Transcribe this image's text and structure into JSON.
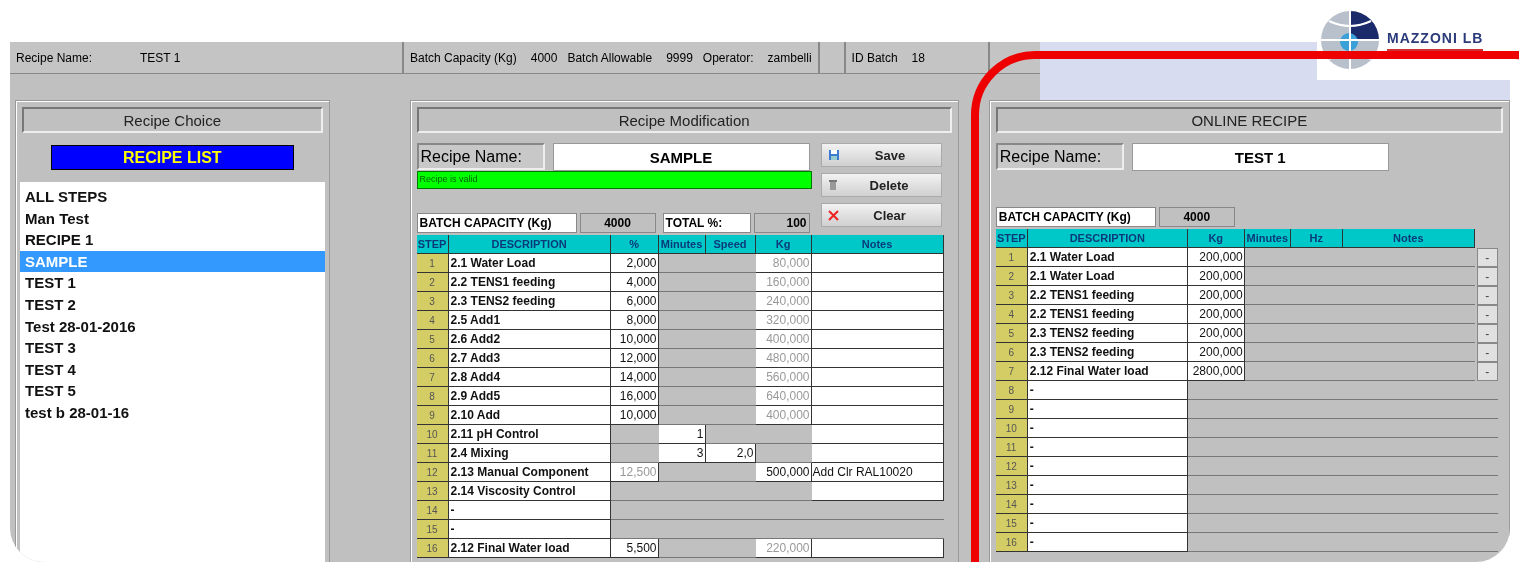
{
  "header": {
    "fields": [
      {
        "label": "Recipe Name:",
        "value": "TEST 1"
      },
      {
        "label": "Batch Capacity (Kg)",
        "value": "4000"
      },
      {
        "label": "Batch Allowable",
        "value": "9999"
      },
      {
        "label": "Operator:",
        "value": "zambelli"
      },
      {
        "label": "ID Batch",
        "value": "18"
      }
    ]
  },
  "logo": {
    "text": "MAZZONI LB"
  },
  "recipe_choice": {
    "title": "Recipe Choice",
    "list_button": "RECIPE LIST",
    "items": [
      {
        "label": "ALL STEPS",
        "selected": false
      },
      {
        "label": "Man Test",
        "selected": false
      },
      {
        "label": "RECIPE 1",
        "selected": false
      },
      {
        "label": "SAMPLE",
        "selected": true
      },
      {
        "label": "TEST 1",
        "selected": false
      },
      {
        "label": "TEST 2",
        "selected": false
      },
      {
        "label": "Test 28-01-2016",
        "selected": false
      },
      {
        "label": "TEST 3",
        "selected": false
      },
      {
        "label": "TEST 4",
        "selected": false
      },
      {
        "label": "TEST 5",
        "selected": false
      },
      {
        "label": "test b 28-01-16",
        "selected": false
      }
    ]
  },
  "recipe_modification": {
    "title": "Recipe Modification",
    "name_label": "Recipe Name:",
    "name_value": "SAMPLE",
    "status": "Recipe is valid",
    "buttons": [
      "Save",
      "Delete",
      "Clear"
    ],
    "capacity_label": "BATCH CAPACITY (Kg)",
    "capacity_value": "4000",
    "total_label": "TOTAL %:",
    "total_value": "100",
    "columns": [
      "STEP",
      "DESCRIPTION",
      "%",
      "Minutes",
      "Speed",
      "Kg",
      "Notes"
    ],
    "rows": [
      {
        "cells": [
          {
            "kind": "step",
            "text": "1"
          },
          {
            "kind": "value",
            "text": "2.1 Water Load"
          },
          {
            "kind": "value",
            "text": "2,000"
          },
          {
            "kind": "blank"
          },
          {
            "kind": "blank"
          },
          {
            "kind": "readonly",
            "text": "80,000"
          },
          {
            "kind": "value"
          }
        ]
      },
      {
        "cells": [
          {
            "kind": "step",
            "text": "2"
          },
          {
            "kind": "value",
            "text": "2.2 TENS1 feeding"
          },
          {
            "kind": "value",
            "text": "4,000"
          },
          {
            "kind": "blank"
          },
          {
            "kind": "blank"
          },
          {
            "kind": "readonly",
            "text": "160,000"
          },
          {
            "kind": "value"
          }
        ]
      },
      {
        "cells": [
          {
            "kind": "step",
            "text": "3"
          },
          {
            "kind": "value",
            "text": "2.3 TENS2 feeding"
          },
          {
            "kind": "value",
            "text": "6,000"
          },
          {
            "kind": "blank"
          },
          {
            "kind": "blank"
          },
          {
            "kind": "readonly",
            "text": "240,000"
          },
          {
            "kind": "value"
          }
        ]
      },
      {
        "cells": [
          {
            "kind": "step",
            "text": "4"
          },
          {
            "kind": "value",
            "text": "2.5 Add1"
          },
          {
            "kind": "value",
            "text": "8,000"
          },
          {
            "kind": "blank"
          },
          {
            "kind": "blank"
          },
          {
            "kind": "readonly",
            "text": "320,000"
          },
          {
            "kind": "value"
          }
        ]
      },
      {
        "cells": [
          {
            "kind": "step",
            "text": "5"
          },
          {
            "kind": "value",
            "text": "2.6 Add2"
          },
          {
            "kind": "value",
            "text": "10,000"
          },
          {
            "kind": "blank"
          },
          {
            "kind": "blank"
          },
          {
            "kind": "readonly",
            "text": "400,000"
          },
          {
            "kind": "value"
          }
        ]
      },
      {
        "cells": [
          {
            "kind": "step",
            "text": "6"
          },
          {
            "kind": "value",
            "text": "2.7 Add3"
          },
          {
            "kind": "value",
            "text": "12,000"
          },
          {
            "kind": "blank"
          },
          {
            "kind": "blank"
          },
          {
            "kind": "readonly",
            "text": "480,000"
          },
          {
            "kind": "value"
          }
        ]
      },
      {
        "cells": [
          {
            "kind": "step",
            "text": "7"
          },
          {
            "kind": "value",
            "text": "2.8 Add4"
          },
          {
            "kind": "value",
            "text": "14,000"
          },
          {
            "kind": "blank"
          },
          {
            "kind": "blank"
          },
          {
            "kind": "readonly",
            "text": "560,000"
          },
          {
            "kind": "value"
          }
        ]
      },
      {
        "cells": [
          {
            "kind": "step",
            "text": "8"
          },
          {
            "kind": "value",
            "text": "2.9 Add5"
          },
          {
            "kind": "value",
            "text": "16,000"
          },
          {
            "kind": "blank"
          },
          {
            "kind": "blank"
          },
          {
            "kind": "readonly",
            "text": "640,000"
          },
          {
            "kind": "value"
          }
        ]
      },
      {
        "cells": [
          {
            "kind": "step",
            "text": "9"
          },
          {
            "kind": "value",
            "text": "2.10 Add"
          },
          {
            "kind": "value",
            "text": "10,000"
          },
          {
            "kind": "blank"
          },
          {
            "kind": "blank"
          },
          {
            "kind": "readonly",
            "text": "400,000"
          },
          {
            "kind": "value"
          }
        ]
      },
      {
        "cells": [
          {
            "kind": "step",
            "text": "10"
          },
          {
            "kind": "value",
            "text": "2.11 pH Control"
          },
          {
            "kind": "blank"
          },
          {
            "kind": "value",
            "text": "1"
          },
          {
            "kind": "blank"
          },
          {
            "kind": "blank"
          },
          {
            "kind": "value"
          }
        ]
      },
      {
        "cells": [
          {
            "kind": "step",
            "text": "11"
          },
          {
            "kind": "value",
            "text": "2.4 Mixing"
          },
          {
            "kind": "blank"
          },
          {
            "kind": "value",
            "text": "3"
          },
          {
            "kind": "value",
            "text": "2,0"
          },
          {
            "kind": "blank"
          },
          {
            "kind": "value"
          }
        ]
      },
      {
        "cells": [
          {
            "kind": "step",
            "text": "12"
          },
          {
            "kind": "value",
            "text": "2.13 Manual Component"
          },
          {
            "kind": "readonly",
            "text": "12,500"
          },
          {
            "kind": "blank"
          },
          {
            "kind": "blank"
          },
          {
            "kind": "value",
            "text": "500,000"
          },
          {
            "kind": "value",
            "text": "Add Clr RAL10020"
          }
        ]
      },
      {
        "cells": [
          {
            "kind": "step",
            "text": "13"
          },
          {
            "kind": "value",
            "text": "2.14 Viscosity Control"
          },
          {
            "kind": "blank"
          },
          {
            "kind": "blank"
          },
          {
            "kind": "blank"
          },
          {
            "kind": "blank"
          },
          {
            "kind": "value"
          }
        ]
      },
      {
        "cells": [
          {
            "kind": "step",
            "text": "14"
          },
          {
            "kind": "value",
            "text": "-"
          },
          {
            "kind": "blank"
          },
          {
            "kind": "blank"
          },
          {
            "kind": "blank"
          },
          {
            "kind": "blank"
          },
          {
            "kind": "blank"
          }
        ]
      },
      {
        "cells": [
          {
            "kind": "step",
            "text": "15"
          },
          {
            "kind": "value",
            "text": "-"
          },
          {
            "kind": "blank"
          },
          {
            "kind": "blank"
          },
          {
            "kind": "blank"
          },
          {
            "kind": "blank"
          },
          {
            "kind": "blank"
          }
        ]
      },
      {
        "cells": [
          {
            "kind": "step",
            "text": "16"
          },
          {
            "kind": "value",
            "text": "2.12 Final Water load"
          },
          {
            "kind": "value",
            "text": "5,500"
          },
          {
            "kind": "blank"
          },
          {
            "kind": "blank"
          },
          {
            "kind": "readonly",
            "text": "220,000"
          },
          {
            "kind": "value"
          }
        ]
      }
    ]
  },
  "online_recipe": {
    "title": "ONLINE RECIPE",
    "name_label": "Recipe Name:",
    "name_value": "TEST 1",
    "capacity_label": "BATCH CAPACITY (Kg)",
    "capacity_value": "4000",
    "columns": [
      "STEP",
      "DESCRIPTION",
      "Kg",
      "Minutes",
      "Hz",
      "Notes"
    ],
    "rows": [
      {
        "cells": [
          {
            "kind": "step",
            "text": "1"
          },
          {
            "kind": "value",
            "text": "2.1 Water Load"
          },
          {
            "kind": "value",
            "text": "200,000"
          },
          {
            "kind": "blank"
          },
          {
            "kind": "blank"
          },
          {
            "kind": "blank"
          },
          {
            "kind": "button",
            "text": "-"
          }
        ]
      },
      {
        "cells": [
          {
            "kind": "step",
            "text": "2"
          },
          {
            "kind": "value",
            "text": "2.1 Water Load"
          },
          {
            "kind": "value",
            "text": "200,000"
          },
          {
            "kind": "blank"
          },
          {
            "kind": "blank"
          },
          {
            "kind": "blank"
          },
          {
            "kind": "button",
            "text": "-"
          }
        ]
      },
      {
        "cells": [
          {
            "kind": "step",
            "text": "3"
          },
          {
            "kind": "value",
            "text": "2.2 TENS1 feeding"
          },
          {
            "kind": "value",
            "text": "200,000"
          },
          {
            "kind": "blank"
          },
          {
            "kind": "blank"
          },
          {
            "kind": "blank"
          },
          {
            "kind": "button",
            "text": "-"
          }
        ]
      },
      {
        "cells": [
          {
            "kind": "step",
            "text": "4"
          },
          {
            "kind": "value",
            "text": "2.2 TENS1 feeding"
          },
          {
            "kind": "value",
            "text": "200,000"
          },
          {
            "kind": "blank"
          },
          {
            "kind": "blank"
          },
          {
            "kind": "blank"
          },
          {
            "kind": "button",
            "text": "-"
          }
        ]
      },
      {
        "cells": [
          {
            "kind": "step",
            "text": "5"
          },
          {
            "kind": "value",
            "text": "2.3 TENS2 feeding"
          },
          {
            "kind": "value",
            "text": "200,000"
          },
          {
            "kind": "blank"
          },
          {
            "kind": "blank"
          },
          {
            "kind": "blank"
          },
          {
            "kind": "button",
            "text": "-"
          }
        ]
      },
      {
        "cells": [
          {
            "kind": "step",
            "text": "6"
          },
          {
            "kind": "value",
            "text": "2.3 TENS2 feeding"
          },
          {
            "kind": "value",
            "text": "200,000"
          },
          {
            "kind": "blank"
          },
          {
            "kind": "blank"
          },
          {
            "kind": "blank"
          },
          {
            "kind": "button",
            "text": "-"
          }
        ]
      },
      {
        "cells": [
          {
            "kind": "step",
            "text": "7"
          },
          {
            "kind": "value",
            "text": "2.12 Final Water load"
          },
          {
            "kind": "value",
            "text": "2800,000"
          },
          {
            "kind": "blank"
          },
          {
            "kind": "blank"
          },
          {
            "kind": "blank"
          },
          {
            "kind": "button",
            "text": "-"
          }
        ]
      },
      {
        "cells": [
          {
            "kind": "step",
            "text": "8"
          },
          {
            "kind": "value",
            "text": "-"
          },
          {
            "kind": "blank"
          },
          {
            "kind": "blank"
          },
          {
            "kind": "blank"
          },
          {
            "kind": "blank"
          },
          {
            "kind": "blank"
          }
        ]
      },
      {
        "cells": [
          {
            "kind": "step",
            "text": "9"
          },
          {
            "kind": "value",
            "text": "-"
          },
          {
            "kind": "blank"
          },
          {
            "kind": "blank"
          },
          {
            "kind": "blank"
          },
          {
            "kind": "blank"
          },
          {
            "kind": "blank"
          }
        ]
      },
      {
        "cells": [
          {
            "kind": "step",
            "text": "10"
          },
          {
            "kind": "value",
            "text": "-"
          },
          {
            "kind": "blank"
          },
          {
            "kind": "blank"
          },
          {
            "kind": "blank"
          },
          {
            "kind": "blank"
          },
          {
            "kind": "blank"
          }
        ]
      },
      {
        "cells": [
          {
            "kind": "step",
            "text": "11"
          },
          {
            "kind": "value",
            "text": "-"
          },
          {
            "kind": "blank"
          },
          {
            "kind": "blank"
          },
          {
            "kind": "blank"
          },
          {
            "kind": "blank"
          },
          {
            "kind": "blank"
          }
        ]
      },
      {
        "cells": [
          {
            "kind": "step",
            "text": "12"
          },
          {
            "kind": "value",
            "text": "-"
          },
          {
            "kind": "blank"
          },
          {
            "kind": "blank"
          },
          {
            "kind": "blank"
          },
          {
            "kind": "blank"
          },
          {
            "kind": "blank"
          }
        ]
      },
      {
        "cells": [
          {
            "kind": "step",
            "text": "13"
          },
          {
            "kind": "value",
            "text": "-"
          },
          {
            "kind": "blank"
          },
          {
            "kind": "blank"
          },
          {
            "kind": "blank"
          },
          {
            "kind": "blank"
          },
          {
            "kind": "blank"
          }
        ]
      },
      {
        "cells": [
          {
            "kind": "step",
            "text": "14"
          },
          {
            "kind": "value",
            "text": "-"
          },
          {
            "kind": "blank"
          },
          {
            "kind": "blank"
          },
          {
            "kind": "blank"
          },
          {
            "kind": "blank"
          },
          {
            "kind": "blank"
          }
        ]
      },
      {
        "cells": [
          {
            "kind": "step",
            "text": "15"
          },
          {
            "kind": "value",
            "text": "-"
          },
          {
            "kind": "blank"
          },
          {
            "kind": "blank"
          },
          {
            "kind": "blank"
          },
          {
            "kind": "blank"
          },
          {
            "kind": "blank"
          }
        ]
      },
      {
        "cells": [
          {
            "kind": "step",
            "text": "16"
          },
          {
            "kind": "value",
            "text": "-"
          },
          {
            "kind": "blank"
          },
          {
            "kind": "blank"
          },
          {
            "kind": "blank"
          },
          {
            "kind": "blank"
          },
          {
            "kind": "blank"
          }
        ]
      }
    ]
  }
}
